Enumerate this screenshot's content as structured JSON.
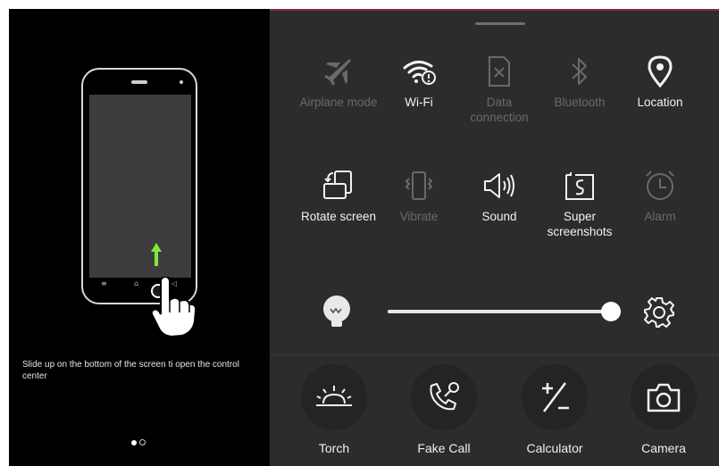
{
  "onboarding": {
    "hint_text": "Slide up on the bottom of the screen ti open the control center",
    "page_indicator": {
      "total": 2,
      "current": 1
    },
    "phone_nav_glyphs": [
      "≡",
      "⌂",
      "◁"
    ]
  },
  "control_center": {
    "toggles": [
      {
        "label": "Airplane mode",
        "icon": "airplane-icon",
        "active": false
      },
      {
        "label": "Wi-Fi",
        "icon": "wifi-icon",
        "active": true
      },
      {
        "label": "Data connection",
        "icon": "data-connection-icon",
        "active": false
      },
      {
        "label": "Bluetooth",
        "icon": "bluetooth-icon",
        "active": false
      },
      {
        "label": "Location",
        "icon": "location-icon",
        "active": true
      },
      {
        "label": "Rotate screen",
        "icon": "rotate-screen-icon",
        "active": true
      },
      {
        "label": "Vibrate",
        "icon": "vibrate-icon",
        "active": false
      },
      {
        "label": "Sound",
        "icon": "sound-icon",
        "active": true
      },
      {
        "label": "Super screenshots",
        "icon": "super-screenshots-icon",
        "active": true
      },
      {
        "label": "Alarm",
        "icon": "alarm-icon",
        "active": false
      }
    ],
    "brightness": {
      "level": 1.0,
      "icon": "brightness-bulb-icon"
    },
    "shortcuts": [
      {
        "label": "Torch",
        "icon": "torch-icon"
      },
      {
        "label": "Fake Call",
        "icon": "fake-call-icon"
      },
      {
        "label": "Calculator",
        "icon": "calculator-icon"
      },
      {
        "label": "Camera",
        "icon": "camera-icon"
      }
    ],
    "colors": {
      "active": "#f2f2f2",
      "inactive": "#6a6a6a",
      "background": "#2c2c2c",
      "accent_line": "#8a2e3a"
    }
  }
}
